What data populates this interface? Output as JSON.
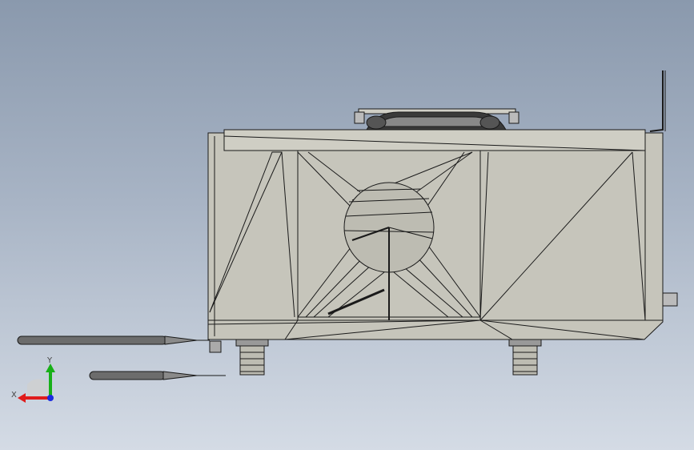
{
  "viewport": {
    "background_top": "#8a99ad",
    "background_bottom": "#d4dbe5",
    "model_face_color": "#c6c5bb",
    "model_edge_color": "#1a1a1a"
  },
  "triad": {
    "x_label": "X",
    "y_label": "Y",
    "x_color": "#e01b1b",
    "y_color": "#18b018",
    "z_color": "#1b2be0"
  }
}
